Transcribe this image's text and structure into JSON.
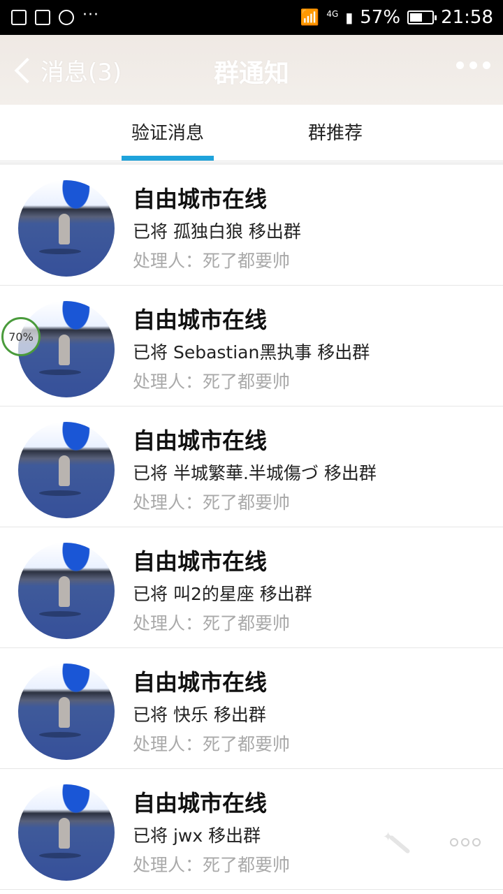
{
  "status_bar": {
    "battery": "57%",
    "time": "21:58",
    "network": "4G",
    "battery_level": 0.57,
    "icons": [
      "image-icon",
      "message-icon",
      "gear-icon",
      "more-icon",
      "wifi-icon",
      "signal-icon",
      "battery-icon"
    ]
  },
  "header": {
    "back_label": "消息(3)",
    "title": "群通知",
    "more_icon": "more-icon"
  },
  "tabs": [
    {
      "label": "验证消息",
      "active": true
    },
    {
      "label": "群推荐",
      "active": false
    }
  ],
  "colors": {
    "accent": "#1fa3db",
    "header_bg": "#efe9e4",
    "secondary_text": "#a9a9a9"
  },
  "notifications": [
    {
      "group": "自由城市在线",
      "action": "已将 孤独白狼 移出群",
      "handler": "处理人：死了都要帅"
    },
    {
      "group": "自由城市在线",
      "action": "已将 Sebastian黑执事 移出群",
      "handler": "处理人：死了都要帅"
    },
    {
      "group": "自由城市在线",
      "action": "已将 半城繁華.半城傷づ 移出群",
      "handler": "处理人：死了都要帅"
    },
    {
      "group": "自由城市在线",
      "action": "已将 叫2的星座 移出群",
      "handler": "处理人：死了都要帅"
    },
    {
      "group": "自由城市在线",
      "action": "已将 快乐 移出群",
      "handler": "处理人：死了都要帅"
    },
    {
      "group": "自由城市在线",
      "action": "已将 jwx 移出群",
      "handler": "处理人：死了都要帅"
    }
  ],
  "overlay": {
    "progress_label": "70%",
    "progress_value": 0.7
  }
}
